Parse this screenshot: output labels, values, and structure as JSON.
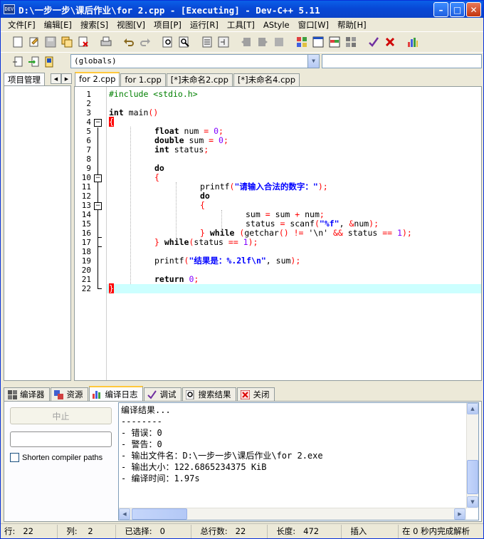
{
  "window": {
    "title": "D:\\一步一步\\课后作业\\for 2.cpp - [Executing] - Dev-C++ 5.11",
    "icon_text": "DEV",
    "controls": [
      "minimize-icon",
      "maximize-icon",
      "close-icon"
    ],
    "minimize_glyph": "–",
    "maximize_glyph": "□",
    "close_glyph": "✕"
  },
  "menu": [
    "文件[F]",
    "编辑[E]",
    "搜索[S]",
    "视图[V]",
    "项目[P]",
    "运行[R]",
    "工具[T]",
    "AStyle",
    "窗口[W]",
    "帮助[H]"
  ],
  "toolbar": {
    "scope_combo": "(globals)",
    "combo_arrow": "▼"
  },
  "left_panel": {
    "tab_label": "项目管理",
    "prev_arrow": "◀",
    "next_arrow": "▶"
  },
  "editor": {
    "tabs": [
      "for 2.cpp",
      "for 1.cpp",
      "[*]未命名2.cpp",
      "[*]未命名4.cpp"
    ],
    "active_tab": 0,
    "line_numbers": [
      "1",
      "2",
      "3",
      "4",
      "5",
      "6",
      "7",
      "8",
      "9",
      "10",
      "11",
      "12",
      "13",
      "14",
      "15",
      "16",
      "17",
      "18",
      "19",
      "20",
      "21",
      "22"
    ],
    "fold_minus": "−",
    "code": {
      "l1": "#include <stdio.h>",
      "l3_kw": "int",
      "l3_rest": " main",
      "l3_sym": "()",
      "l4": "{",
      "l5_kw": "float",
      "l5_mid": " num ",
      "l5_eq": "=",
      "l5_num": " 0",
      "l5_end": ";",
      "l6_kw": "double",
      "l6_mid": " sum ",
      "l6_eq": "=",
      "l6_num": " 0",
      "l6_end": ";",
      "l7_kw": "int",
      "l7_mid": " status",
      "l7_end": ";",
      "l9_kw": "do",
      "l10": "{",
      "l11_fn": "printf",
      "l11_p": "(",
      "l11_str": "\"请输入合法的数字：\"",
      "l11_end": ");",
      "l12_kw": "do",
      "l13": "{",
      "l14_a": "sum ",
      "l14_eq": "=",
      "l14_b": " sum ",
      "l14_plus": "+",
      "l14_c": " num",
      "l14_end": ";",
      "l15_a": "status ",
      "l15_eq": "=",
      "l15_b": " scanf",
      "l15_p": "(",
      "l15_str": "\"%f\"",
      "l15_c": ", ",
      "l15_amp": "&",
      "l15_d": "num",
      "l15_end": ");",
      "l16_brace": "}",
      "l16_kw": " while",
      "l16_p": " (",
      "l16_a": "getchar",
      "l16_p2": "()",
      "l16_ne": " !=",
      "l16_chr": " '\\n'",
      "l16_and": " &&",
      "l16_b": " status ",
      "l16_eqeq": "==",
      "l16_num": " 1",
      "l16_end": ");",
      "l17_brace": "}",
      "l17_kw": " while",
      "l17_p": "(",
      "l17_a": "status ",
      "l17_eqeq": "==",
      "l17_num": " 1",
      "l17_end": ");",
      "l19_fn": "printf",
      "l19_p": "(",
      "l19_str": "\"结果是：%.2lf\\n\"",
      "l19_c": ", sum",
      "l19_end": ");",
      "l21_kw": "return",
      "l21_num": " 0",
      "l21_end": ";",
      "l22": "}"
    }
  },
  "bottom": {
    "tabs": [
      {
        "label": "编译器",
        "icon": "grid-icon"
      },
      {
        "label": "资源",
        "icon": "resources-icon"
      },
      {
        "label": "编译日志",
        "icon": "bar-chart-icon"
      },
      {
        "label": "调试",
        "icon": "checkmark-icon"
      },
      {
        "label": "搜索结果",
        "icon": "search-icon"
      },
      {
        "label": "关闭",
        "icon": "close-icon"
      }
    ],
    "active_tab": 2,
    "stop_button": "中止",
    "shorten_paths_label": "Shorten compiler paths",
    "log": [
      "编译结果...",
      "--------",
      "- 错误：0",
      "- 警告：0",
      "- 输出文件名：D:\\一步一步\\课后作业\\for 2.exe",
      "- 输出大小：122.6865234375 KiB",
      "- 编译时间：1.97s"
    ],
    "scroll_up": "▲",
    "scroll_down": "▼",
    "scroll_left": "◀",
    "scroll_right": "▶"
  },
  "status": {
    "row_label": "行:",
    "row": "22",
    "col_label": "列:",
    "col": "2",
    "sel_label": "已选择:",
    "sel": "0",
    "lines_label": "总行数:",
    "lines": "22",
    "len_label": "长度:",
    "len": "472",
    "mode": "插入",
    "parse": "在 0 秒内完成解析"
  },
  "colors": {
    "title_bar": "#0848d6",
    "keyword": "#000000",
    "preprocessor": "#008000",
    "string": "#0000ff",
    "number": "#8000ff",
    "symbol": "#ff0000",
    "current_line": "#ccffff"
  }
}
